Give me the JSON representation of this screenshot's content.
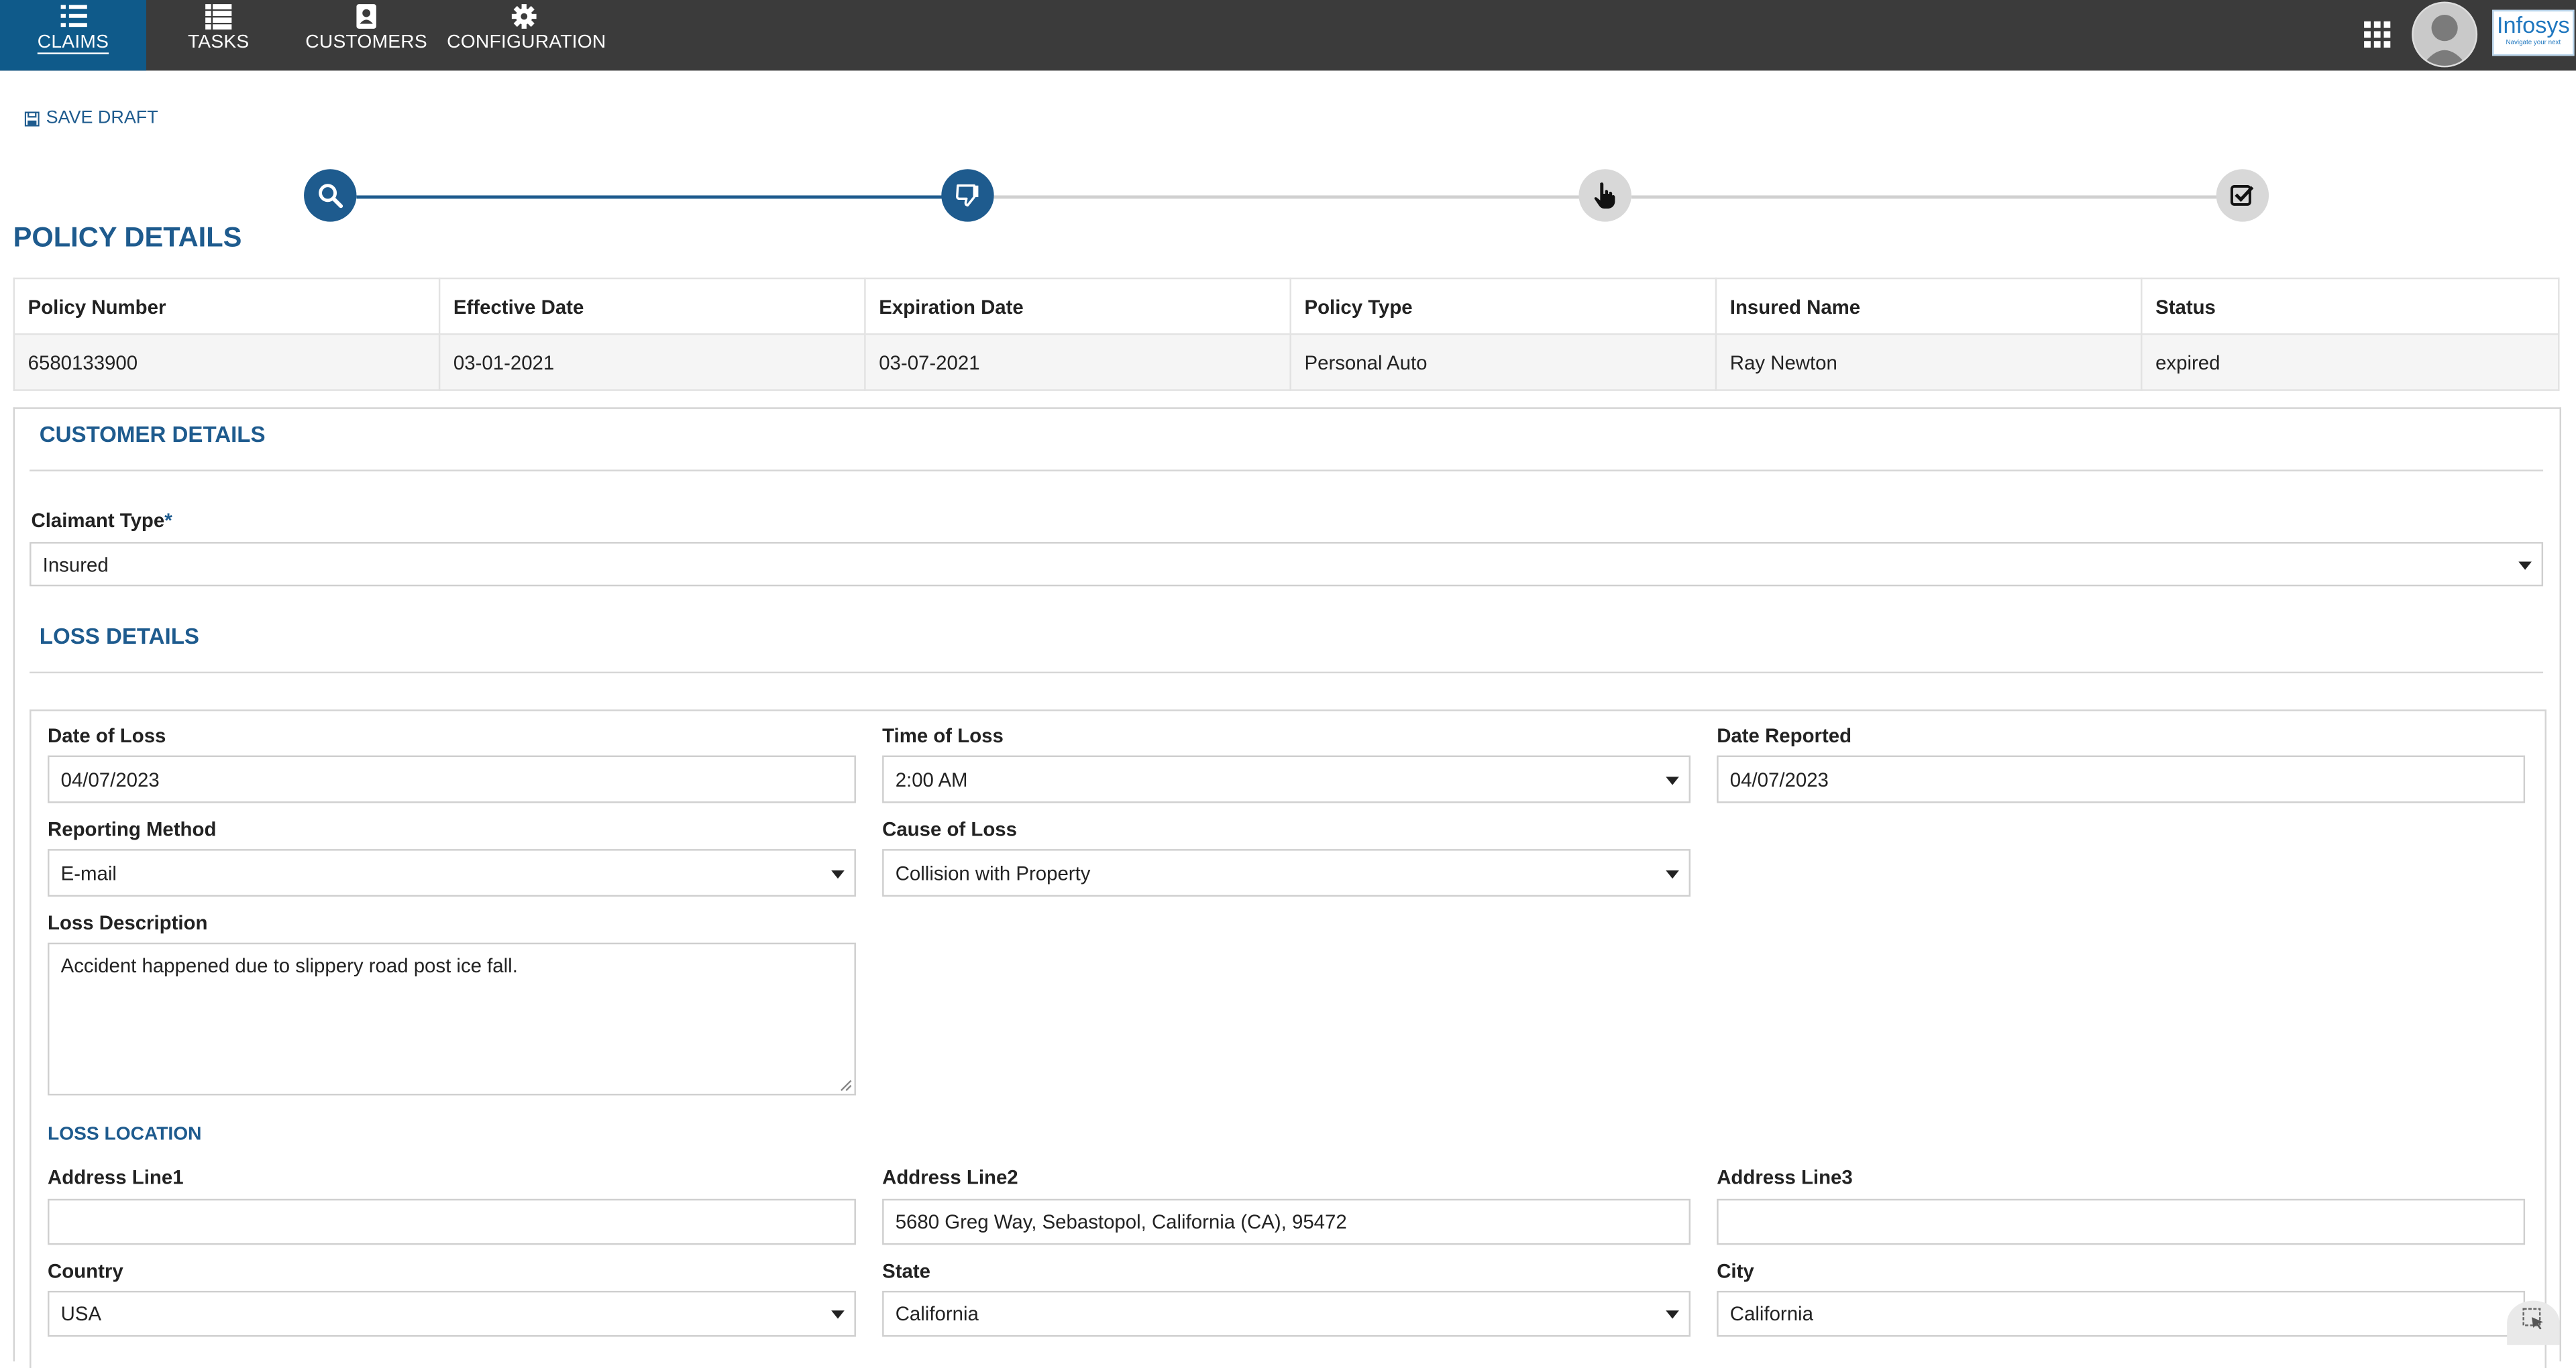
{
  "nav": {
    "items": [
      {
        "label": "CLAIMS",
        "icon": "list-icon",
        "active": true
      },
      {
        "label": "TASKS",
        "icon": "tasks-icon",
        "active": false
      },
      {
        "label": "CUSTOMERS",
        "icon": "contacts-icon",
        "active": false
      },
      {
        "label": "CONFIGURATION",
        "icon": "gear-icon",
        "active": false
      }
    ],
    "apps_icon": "grid-icon",
    "brand": {
      "name": "Infosys",
      "tagline": "Navigate your next"
    }
  },
  "toolbar": {
    "save_draft_label": "SAVE DRAFT"
  },
  "stepper": {
    "steps": [
      {
        "icon": "search-icon",
        "state": "complete"
      },
      {
        "icon": "thumbs-down-icon",
        "state": "complete"
      },
      {
        "icon": "hand-pointer-icon",
        "state": "pending"
      },
      {
        "icon": "check-square-icon",
        "state": "pending"
      }
    ]
  },
  "policy": {
    "title": "POLICY DETAILS",
    "headers": [
      "Policy Number",
      "Effective Date",
      "Expiration Date",
      "Policy Type",
      "Insured Name",
      "Status"
    ],
    "row": [
      "6580133900",
      "03-01-2021",
      "03-07-2021",
      "Personal Auto",
      "Ray Newton",
      "expired"
    ]
  },
  "customer": {
    "title": "CUSTOMER DETAILS",
    "claimant_type_label": "Claimant Type",
    "required_mark": "*",
    "claimant_type_value": "Insured"
  },
  "loss": {
    "title": "LOSS DETAILS",
    "date_of_loss_label": "Date of Loss",
    "date_of_loss_value": "04/07/2023",
    "time_of_loss_label": "Time of Loss",
    "time_of_loss_value": "2:00 AM",
    "date_reported_label": "Date Reported",
    "date_reported_value": "04/07/2023",
    "reporting_method_label": "Reporting Method",
    "reporting_method_value": "E-mail",
    "cause_of_loss_label": "Cause of Loss",
    "cause_of_loss_value": "Collision with Property",
    "description_label": "Loss Description",
    "description_value": "Accident happened due to slippery road post ice fall."
  },
  "location": {
    "title": "LOSS LOCATION",
    "address1_label": "Address Line1",
    "address1_value": "",
    "address2_label": "Address Line2",
    "address2_value": "5680 Greg Way, Sebastopol, California (CA), 95472",
    "address3_label": "Address Line3",
    "address3_value": "",
    "country_label": "Country",
    "country_value": "USA",
    "state_label": "State",
    "state_value": "California",
    "city_label": "City",
    "city_value": "California"
  },
  "colors": {
    "nav_bg": "#3b3b3b",
    "nav_active": "#0f5a8a",
    "accent": "#1e5b8e",
    "step_pending": "#d8d8d8"
  }
}
